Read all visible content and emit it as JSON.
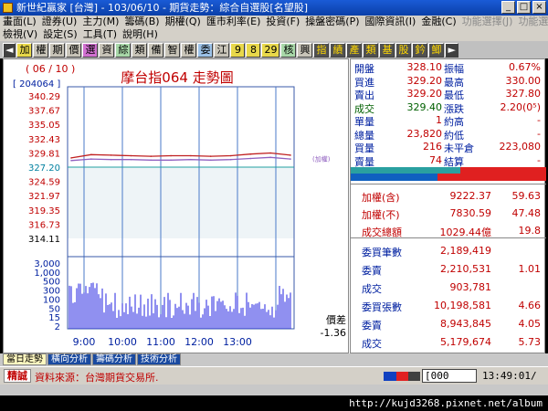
{
  "window": {
    "title": "新世紀贏家 [台灣] - 103/06/10 - 期貨走勢：綜合自選股[名望股]"
  },
  "menus": {
    "row1": [
      "畫面(L)",
      "證券(U)",
      "主力(M)",
      "籌碼(B)",
      "期權(Q)",
      "匯市利率(E)",
      "投資(F)",
      "操盤密碼(P)",
      "國際資訊(I)",
      "金融(C)",
      "功能選擇(J)",
      "功能選擇(K)"
    ],
    "row2": [
      "檢視(V)",
      "設定(S)",
      "工具(T)",
      "說明(H)"
    ]
  },
  "toolbar": {
    "buttons": [
      "加",
      "權",
      "期",
      "價",
      "選",
      "資",
      "綜",
      "類",
      "備",
      "智",
      "權",
      "委",
      "江",
      "9",
      "8",
      "29",
      "核",
      "興",
      "指",
      "績",
      "產",
      "類",
      "基",
      "股",
      "鈐",
      "鯽"
    ]
  },
  "chart": {
    "date_label": "( 06 / 10 )",
    "code_label": "[ 204064 ]",
    "title": "摩台指064  走勢圖",
    "price_ticks": [
      "340.29",
      "337.67",
      "335.05",
      "332.43",
      "329.81",
      "327.20",
      "324.59",
      "321.97",
      "319.35",
      "316.73",
      "314.11"
    ],
    "volume_ticks": [
      "3,000",
      "1,000",
      "500",
      "300",
      "100",
      "50",
      "15",
      "2"
    ],
    "time_ticks": [
      "9:00",
      "10:00",
      "11:00",
      "12:00",
      "13:00"
    ],
    "note_right": "(加權)",
    "diff_label": "價差",
    "diff_value": "-1.36"
  },
  "chart_data": {
    "type": "line",
    "title": "摩台指064  走勢圖",
    "x": [
      "8:45",
      "9:00",
      "9:30",
      "10:00",
      "10:30",
      "11:00",
      "11:30",
      "12:00",
      "12:30",
      "13:00",
      "13:30",
      "13:45"
    ],
    "series": [
      {
        "name": "",
        "values": [
          328.9,
          329.5,
          329.4,
          329.3,
          329.2,
          329.3,
          329.3,
          329.2,
          329.3,
          329.6,
          329.8,
          329.4
        ],
        "color": "#c02020"
      },
      {
        "name": "",
        "values": [
          328.4,
          328.7,
          328.6,
          328.6,
          328.5,
          328.5,
          328.6,
          328.5,
          328.6,
          328.8,
          329.0,
          328.7
        ],
        "color": "#9060c0"
      }
    ],
    "ylim": [
      314.11,
      340.29
    ],
    "reference_line": 327.2
  },
  "quote": {
    "rows": [
      {
        "l1": "開盤",
        "v1": "328.10",
        "l2": "振幅",
        "v2": "0.67%"
      },
      {
        "l1": "買進",
        "v1": "329.20",
        "l2": "最高",
        "v2": "330.00"
      },
      {
        "l1": "賣出",
        "v1": "329.20",
        "l2": "最低",
        "v2": "327.80"
      },
      {
        "l1": "成交",
        "v1": "329.40",
        "l2": "漲跌",
        "v2": "2.20(0⁵)"
      },
      {
        "l1": "單量",
        "v1": "1",
        "l2": "約高",
        "v2": "-"
      },
      {
        "l1": "總量",
        "v1": "23,820",
        "l2": "約低",
        "v2": "-"
      },
      {
        "l1": "買量",
        "v1": "216",
        "l2": "未平倉",
        "v2": "223,080"
      },
      {
        "l1": "賣量",
        "v1": "74",
        "l2": "結算",
        "v2": "-"
      }
    ],
    "index_rows": [
      {
        "label": "加權(含)",
        "value": "9222.37",
        "change": "59.63"
      },
      {
        "label": "加權(不)",
        "value": "7830.59",
        "change": "47.48"
      },
      {
        "label": "成交總額",
        "value": "1029.44億",
        "change": "19.8"
      }
    ],
    "order_rows": [
      {
        "label": "委買筆數",
        "value": "2,189,419",
        "ratio": ""
      },
      {
        "label": "委賣",
        "value": "2,210,531",
        "ratio": "1.01"
      },
      {
        "label": "成交",
        "value": "903,781",
        "ratio": ""
      },
      {
        "label": "委買張數",
        "value": "10,198,581",
        "ratio": "4.66"
      },
      {
        "label": "委賣",
        "value": "8,943,845",
        "ratio": "4.05"
      },
      {
        "label": "成交",
        "value": "5,179,674",
        "ratio": "5.73"
      }
    ]
  },
  "tabs": [
    "當日走勢",
    "橫向分析",
    "籌碼分析",
    "技術分析"
  ],
  "status": {
    "label": "精誠",
    "source": "資料來源：台灣期貨交易所.",
    "code_box": "[000",
    "clock": "13:49:01/"
  },
  "footer_url": "http://kujd3268.pixnet.net/album"
}
